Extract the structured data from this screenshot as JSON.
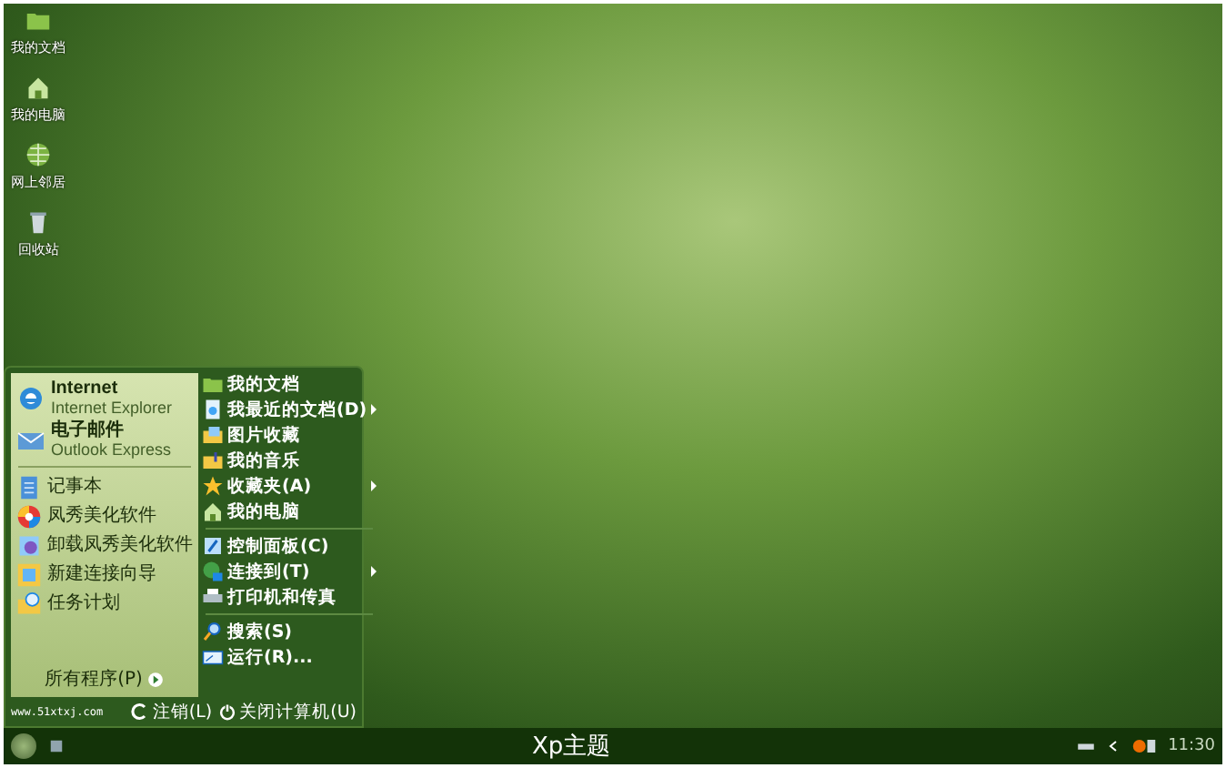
{
  "desktop_icons": [
    {
      "label": "我的文档"
    },
    {
      "label": "我的电脑"
    },
    {
      "label": "网上邻居"
    },
    {
      "label": "回收站"
    }
  ],
  "start_menu": {
    "pinned": [
      {
        "title": "Internet",
        "subtitle": "Internet Explorer"
      },
      {
        "title": "电子邮件",
        "subtitle": "Outlook Express"
      }
    ],
    "recent": [
      {
        "title": "记事本"
      },
      {
        "title": "凤秀美化软件"
      },
      {
        "title": "卸载凤秀美化软件"
      },
      {
        "title": "新建连接向导"
      },
      {
        "title": "任务计划"
      }
    ],
    "all_programs": "所有程序(P)",
    "place_groups": [
      [
        {
          "label": "我的文档",
          "submenu": false
        },
        {
          "label": "我最近的文档(D)",
          "submenu": true
        },
        {
          "label": "图片收藏",
          "submenu": false
        },
        {
          "label": "我的音乐",
          "submenu": false
        },
        {
          "label": "收藏夹(A)",
          "submenu": true
        },
        {
          "label": "我的电脑",
          "submenu": false
        }
      ],
      [
        {
          "label": "控制面板(C)",
          "submenu": false
        },
        {
          "label": "连接到(T)",
          "submenu": true
        },
        {
          "label": "打印机和传真",
          "submenu": false
        }
      ],
      [
        {
          "label": "搜索(S)",
          "submenu": false
        },
        {
          "label": "运行(R)...",
          "submenu": false
        }
      ]
    ],
    "footer": {
      "website": "www.51xtxj.com",
      "logoff": "注销(L)",
      "shutdown": "关闭计算机(U)"
    }
  },
  "taskbar": {
    "caption": "Xp主题",
    "clock": "11:30"
  }
}
